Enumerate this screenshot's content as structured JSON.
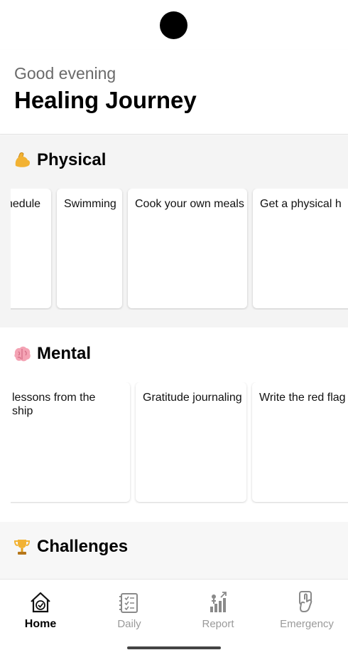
{
  "header": {
    "greeting": "Good evening",
    "title": "Healing Journey"
  },
  "sections": [
    {
      "title": "Physical",
      "emoji_icon": "flexed-biceps-icon",
      "cards": [
        "chedule",
        "Swimming",
        "Cook your own meals",
        "Get a physical h"
      ]
    },
    {
      "title": "Mental",
      "emoji_icon": "brain-icon",
      "cards": [
        "lessons from the ship",
        "Gratitude journaling",
        "Write the red flag"
      ]
    },
    {
      "title": "Challenges",
      "emoji_icon": "trophy-icon",
      "cards": []
    }
  ],
  "tabs": [
    {
      "label": "Home",
      "icon": "home-icon",
      "active": true
    },
    {
      "label": "Daily",
      "icon": "daily-checklist-icon",
      "active": false
    },
    {
      "label": "Report",
      "icon": "report-chart-icon",
      "active": false
    },
    {
      "label": "Emergency",
      "icon": "emergency-tap-icon",
      "active": false
    }
  ],
  "colors": {
    "accent_active": "#000000",
    "tab_inactive": "#9a9a9a",
    "section_bg": "#f4f4f4"
  }
}
